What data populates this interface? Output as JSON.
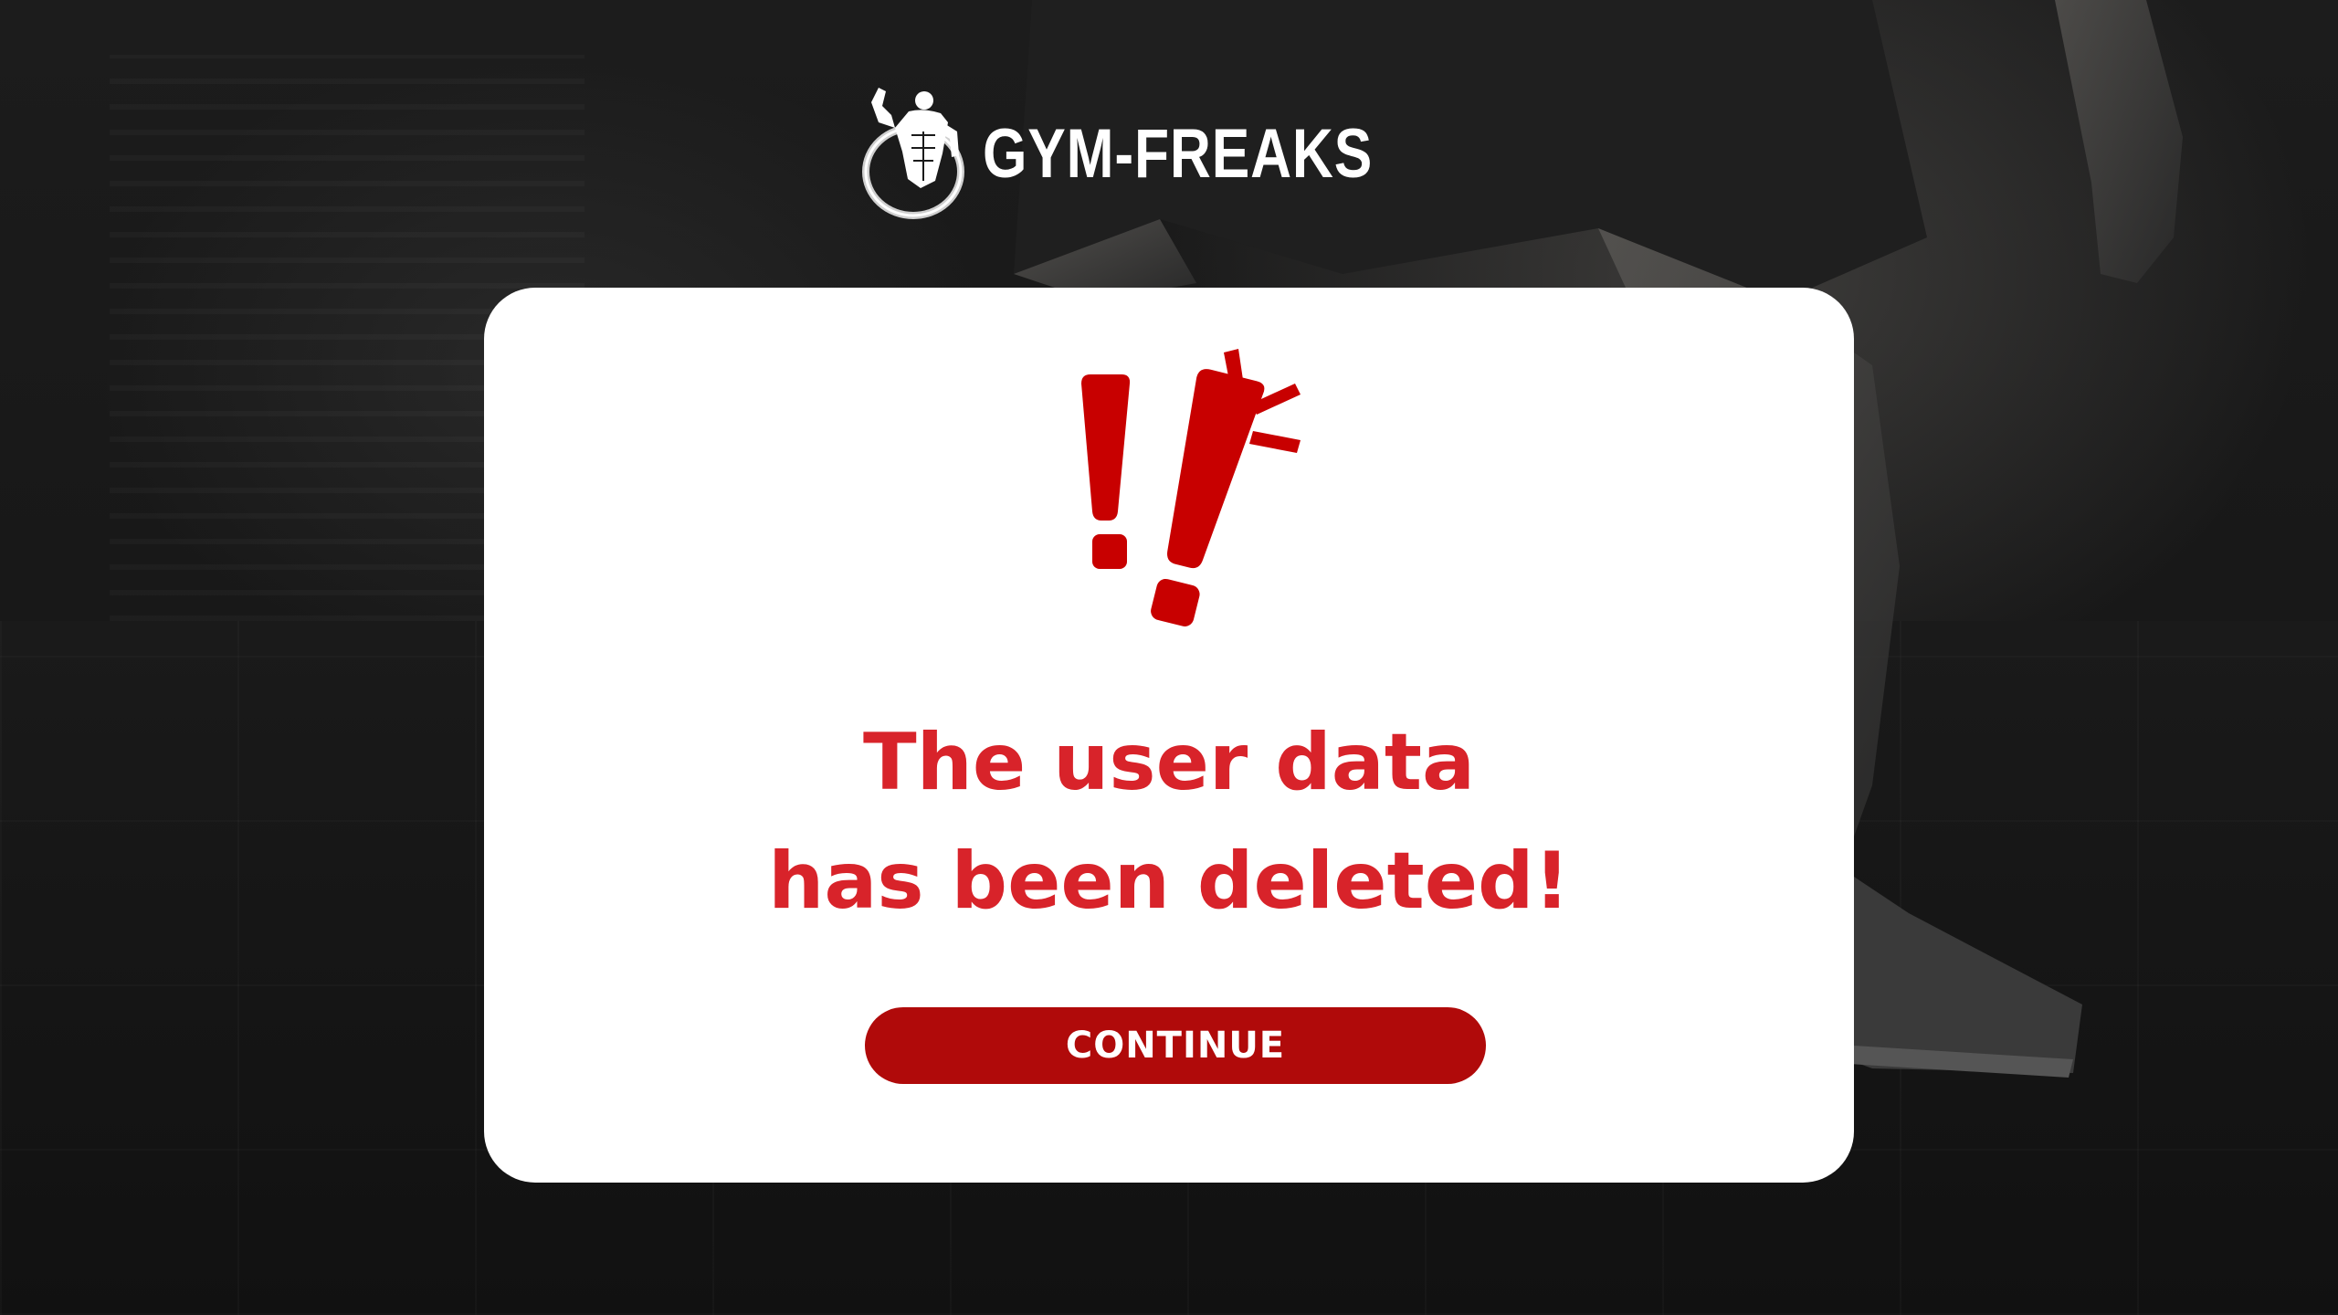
{
  "brand": {
    "name": "GYM-FREAKS",
    "logo_icon": "bodybuilder-logo-icon"
  },
  "dialog": {
    "icon": "exclamation-alert-icon",
    "message_line1": "The user data",
    "message_line2": "has been deleted!",
    "continue_label": "CONTINUE"
  },
  "colors": {
    "accent_red": "#d8232a",
    "button_red": "#b00a0a",
    "card_background": "#ffffff",
    "page_background": "#141414"
  }
}
